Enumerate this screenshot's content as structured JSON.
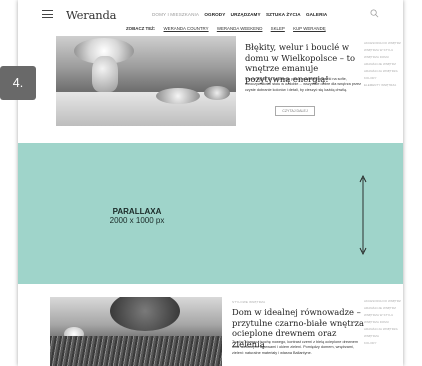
{
  "badge": {
    "step": "4."
  },
  "header": {
    "logo": "Weranda",
    "nav": [
      {
        "label": "DOMY I MIESZKANIA",
        "style": "muted"
      },
      {
        "label": "OGRODY",
        "style": "bold"
      },
      {
        "label": "URZĄDZAMY",
        "style": "bold"
      },
      {
        "label": "SZTUKA ŻYCIA",
        "style": "bold"
      },
      {
        "label": "GALERIA",
        "style": "bold"
      }
    ],
    "see_also_label": "ZOBACZ TEŻ:",
    "see_also_links": [
      "WERANDA COUNTRY",
      "WERANDA WEEKEND",
      "SKLEP",
      "KUP WERANDĘ"
    ]
  },
  "article1": {
    "title": "Błękity, welur i bouclé w domu w Wielkopolsce – to wnętrze emanuje pozytywną energią!",
    "lead": "Ciepło bijące od kaflowego pieca, miękkie poduszki na sofie, nieoczywistości stołu w ozdobie… wszystkie dobre dla wnętrza przez czyste dobranie kolorów i detali, by cieszyć się każdą chwilą.",
    "button": "CZYTAJ DALEJ",
    "tags": [
      "AKCESORIA DO WNĘTRZ",
      "WNĘTRZA W STYLU",
      "WNĘTRZA DOMU",
      "ARANŻACJE WNĘTRZ",
      "ARANŻACJA WNĘTRZA",
      "KOLORY",
      "ELEMENTY WNĘTRZA"
    ]
  },
  "parallax": {
    "label": "PARALLAXA",
    "size": "2000 x 1000 px"
  },
  "article2": {
    "kicker": "STYLOWE WNĘTRZA",
    "title": "Dom w idealnej równowadze – przytulne czarno-białe wnętrza ocieplone drewnem oraz zielenią",
    "lead": "Trochę starego i trochę nowego, kontrast czerni z bielą ocieplone drewnem oraz wiekowymi drzewami i okiem zieleni. Pomiędzy domem, wnętrzami, zieleni: naturalne materiały i własna Ballantyne.",
    "tags": [
      "AKCESORIA DO WNĘTRZ",
      "ARANŻACJE WNĘTRZ",
      "WNĘTRZA W STYLU",
      "WNĘTRZA DOMU",
      "ARANŻACJA WNĘTRZA",
      "WNĘTRZA",
      "KOLORY"
    ]
  }
}
